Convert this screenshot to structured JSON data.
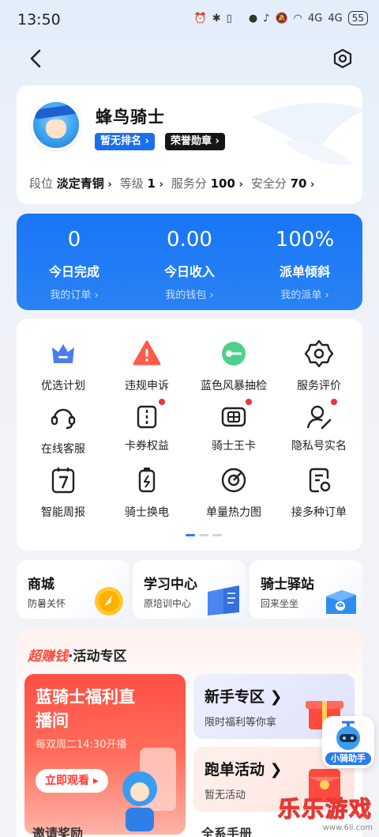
{
  "status_bar": {
    "time": "13:50",
    "battery": "55",
    "signal_label_1": "4G",
    "signal_label_2": "4G"
  },
  "profile": {
    "name": "蜂鸟骑士",
    "rank_badge": "暂无排名",
    "honor_badge": "荣誉勋章",
    "stats": [
      {
        "label": "段位",
        "value": "淡定青铜"
      },
      {
        "label": "等级",
        "value": "1"
      },
      {
        "label": "服务分",
        "value": "100"
      },
      {
        "label": "安全分",
        "value": "70"
      }
    ]
  },
  "today": [
    {
      "value": "0",
      "label": "今日完成",
      "link": "我的订单"
    },
    {
      "value": "0.00",
      "label": "今日收入",
      "link": "我的钱包"
    },
    {
      "value": "100%",
      "label": "派单倾斜",
      "link": "我的派单"
    }
  ],
  "grid": [
    {
      "label": "优选计划",
      "icon": "crown-icon",
      "dot": false
    },
    {
      "label": "违规申诉",
      "icon": "warning-icon",
      "dot": false
    },
    {
      "label": "蓝色风暴抽检",
      "icon": "key-icon",
      "dot": false
    },
    {
      "label": "服务评价",
      "icon": "star-icon",
      "dot": false
    },
    {
      "label": "在线客服",
      "icon": "headset-icon",
      "dot": false
    },
    {
      "label": "卡券权益",
      "icon": "coupon-icon",
      "dot": true
    },
    {
      "label": "骑士王卡",
      "icon": "sim-card-icon",
      "dot": true
    },
    {
      "label": "隐私号实名",
      "icon": "user-edit-icon",
      "dot": true
    },
    {
      "label": "智能周报",
      "icon": "calendar-7-icon",
      "dot": false
    },
    {
      "label": "骑士换电",
      "icon": "battery-icon",
      "dot": false
    },
    {
      "label": "单量热力图",
      "icon": "target-icon",
      "dot": false
    },
    {
      "label": "接多种订单",
      "icon": "order-icon",
      "dot": false
    }
  ],
  "shortcuts": [
    {
      "title": "商城",
      "sub": "防暑关怀"
    },
    {
      "title": "学习中心",
      "sub": "原培训中心"
    },
    {
      "title": "骑士驿站",
      "sub": "回来坐坐"
    }
  ],
  "activity": {
    "hot": "超赚钱",
    "title": "·活动专区",
    "live": {
      "title": "蓝骑士福利直播间",
      "sub": "每双周二14:30开播",
      "button": "立即观看"
    },
    "novice": {
      "title": "新手专区",
      "sub": "限时福利等你拿"
    },
    "run": {
      "title": "跑单活动",
      "sub": "暂无活动"
    },
    "peek_left": "邀请奖励",
    "peek_right": "全系手册"
  },
  "helper": {
    "label": "小骑助手"
  },
  "watermark": {
    "main": "乐乐游戏",
    "url": "www.6ll.com"
  },
  "colors": {
    "accent": "#1876f6",
    "hot": "#ff4a3d",
    "dot": "#f0323c"
  }
}
